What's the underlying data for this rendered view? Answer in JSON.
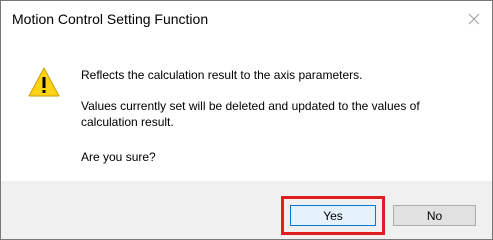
{
  "dialog": {
    "title": "Motion Control Setting Function",
    "messages": [
      "Reflects the calculation result to the axis parameters.",
      "Values currently set will be deleted and updated to the values of calculation result.",
      "Are you sure?"
    ],
    "icon": "warning-icon",
    "buttons": {
      "yes_label": "Yes",
      "no_label": "No"
    }
  },
  "colors": {
    "highlight": "#e02020",
    "accent_border": "#0078d7",
    "footer_background": "#f0f0f0"
  }
}
